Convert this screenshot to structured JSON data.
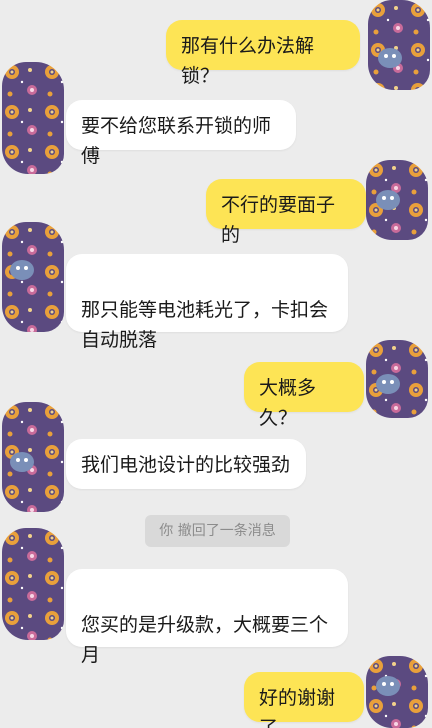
{
  "messages": [
    {
      "side": "out",
      "text": "那有什么办法解锁？"
    },
    {
      "side": "in",
      "text": "要不给您联系开锁的师傅"
    },
    {
      "side": "out",
      "text": "不行的要面子的"
    },
    {
      "side": "in",
      "text": "那只能等电池耗光了，卡扣会\n自动脱落"
    },
    {
      "side": "out",
      "text": "大概多久？"
    },
    {
      "side": "in",
      "text": "我们电池设计的比较强劲"
    },
    {
      "side": "system",
      "text": "你 撤回了一条消息"
    },
    {
      "side": "in",
      "text": "您买的是升级款，大概要三个\n月"
    },
    {
      "side": "out",
      "text": "好的谢谢了"
    }
  ],
  "colors": {
    "background": "#ececec",
    "incoming_bubble": "#ffffff",
    "outgoing_bubble": "#fde455",
    "avatar_purple": "#5b4a80"
  },
  "avatar_icon": "purple-cartoon-pattern-avatar"
}
